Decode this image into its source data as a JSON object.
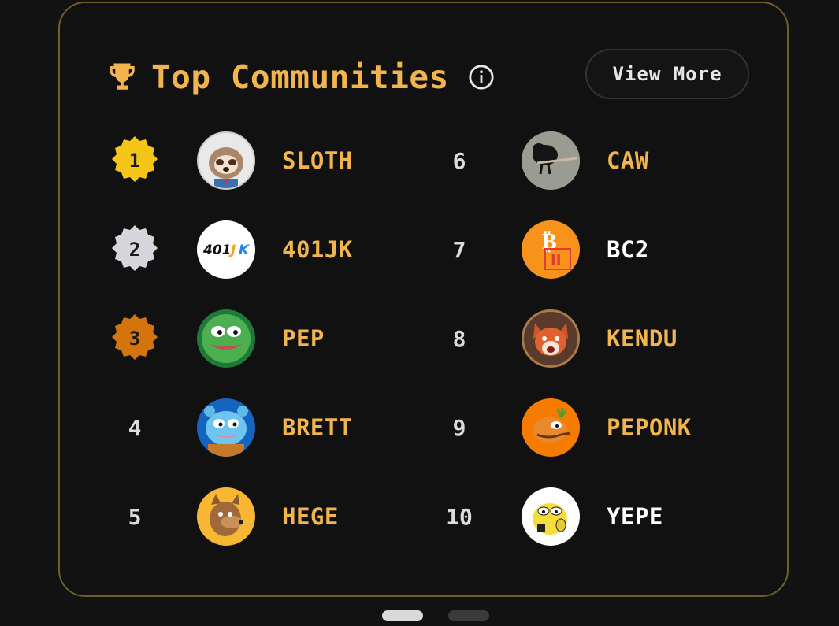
{
  "header": {
    "title": "Top Communities",
    "view_more_label": "View More"
  },
  "colors": {
    "accent": "#f2b44e",
    "gold": "#f5c518",
    "silver": "#d4d6dc",
    "bronze": "#d4740c",
    "white_name": "#ffffff"
  },
  "icons": {
    "title": "trophy-icon",
    "info": "info-icon"
  },
  "communities": [
    {
      "rank": "1",
      "name": "SLOTH",
      "icon": "sloth-avatar"
    },
    {
      "rank": "2",
      "name": "401JK",
      "icon": "401jk-logo"
    },
    {
      "rank": "3",
      "name": "PEP",
      "icon": "pepe-frog-avatar"
    },
    {
      "rank": "4",
      "name": "BRETT",
      "icon": "brett-avatar"
    },
    {
      "rank": "5",
      "name": "HEGE",
      "icon": "hege-avatar"
    },
    {
      "rank": "6",
      "name": "CAW",
      "icon": "crow-avatar"
    },
    {
      "rank": "7",
      "name": "BC2",
      "icon": "bitcoin-logo"
    },
    {
      "rank": "8",
      "name": "KENDU",
      "icon": "shiba-avatar"
    },
    {
      "rank": "9",
      "name": "PEPONK",
      "icon": "orange-frog-avatar"
    },
    {
      "rank": "10",
      "name": "YEPE",
      "icon": "yellow-frog-avatar"
    }
  ],
  "pager": {
    "pages": 2,
    "active": 1
  }
}
